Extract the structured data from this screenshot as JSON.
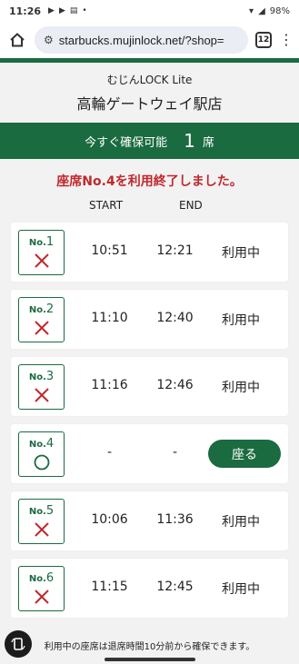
{
  "statusbar": {
    "time": "11:26",
    "battery": "98%"
  },
  "browser": {
    "url": "starbucks.mujinlock.net/?shop=",
    "tab_count": "12"
  },
  "header": {
    "brand": "むじんLOCK Lite",
    "store": "高輪ゲートウェイ駅店"
  },
  "availability": {
    "label": "今すぐ確保可能",
    "count": "1",
    "unit": "席"
  },
  "notice": "座席No.4を利用終了しました。",
  "columns": {
    "start": "START",
    "end": "END"
  },
  "seats": [
    {
      "no_prefix": "No.",
      "no": "1",
      "mark": "cross",
      "start": "10:51",
      "end": "12:21",
      "status": "利用中"
    },
    {
      "no_prefix": "No.",
      "no": "2",
      "mark": "cross",
      "start": "11:10",
      "end": "12:40",
      "status": "利用中"
    },
    {
      "no_prefix": "No.",
      "no": "3",
      "mark": "cross",
      "start": "11:16",
      "end": "12:46",
      "status": "利用中"
    },
    {
      "no_prefix": "No.",
      "no": "4",
      "mark": "circle",
      "start": "-",
      "end": "-",
      "action": "座る"
    },
    {
      "no_prefix": "No.",
      "no": "5",
      "mark": "cross",
      "start": "10:06",
      "end": "11:36",
      "status": "利用中"
    },
    {
      "no_prefix": "No.",
      "no": "6",
      "mark": "cross",
      "start": "11:15",
      "end": "12:45",
      "status": "利用中"
    }
  ],
  "footnote": "利用中の座席は退席時間10分前から確保できます。",
  "colors": {
    "brand_green": "#1a6b3f",
    "alert_red": "#c0282d"
  }
}
